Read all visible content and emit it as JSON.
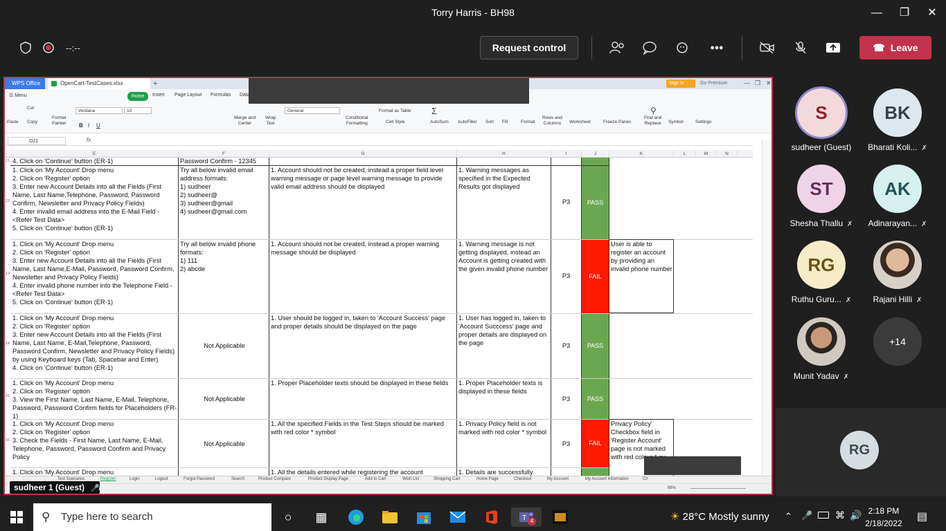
{
  "window": {
    "title": "Torry Harris - BH98"
  },
  "toolbar": {
    "timer": "--:--",
    "request_control": "Request control",
    "leave": "Leave"
  },
  "wps": {
    "app_tab": "WPS Office",
    "file_tab": "OpenCart-TestCases.xlsx",
    "sign_in": "Sign in",
    "go_premium": "Go Premium",
    "menu": [
      "Menu",
      "Home",
      "Insert",
      "Page Layout",
      "Formulas",
      "Data"
    ],
    "ribbon": {
      "paste": "Paste",
      "cut": "Cut",
      "copy": "Copy",
      "format_painter": "Format\nPainter",
      "font_name": "Verdana",
      "font_size": "10",
      "number_format": "General",
      "merge_center": "Merge and\nCenter",
      "wrap_text": "Wrap\nText",
      "conditional_formatting": "Conditional\nFormatting",
      "format_as_table": "Format as Table",
      "cell_style": "Cell Style",
      "autosum": "AutoSum",
      "autofilter": "AutoFilter",
      "sort": "Sort",
      "fill": "Fill",
      "format": "Format",
      "rows_columns": "Rows and\nColumns",
      "worksheet": "Worksheet",
      "freeze_panes": "Freeze Panes",
      "find_replace": "Find and\nReplace",
      "symbol": "Symbol",
      "settings": "Settings"
    },
    "cell_ref": "O21",
    "fx": "fx",
    "columns": [
      "E",
      "F",
      "G",
      "H",
      "I",
      "J",
      "K",
      "L",
      "M",
      "N"
    ],
    "top_row": {
      "num": "11",
      "e": "4. Click on 'Continue' button (ER-1)",
      "f": "Password Confirm - 12345"
    },
    "rows": [
      {
        "num": "12",
        "e": "1. Click on 'My Account' Drop menu\n2. Click on 'Register' option\n3. Enter new Account Details into all the Fields (First Name, Last Name,Telephone, Password, Password Confirm, Newsletter and  Privacy Policy Fields)\n4. Enter invalid email address into the E-Mail Field - <Refer Test Data>\n5. Click on 'Continue' button (ER-1)",
        "f": "Try all below invalid email address formats:\n1) sudheer\n2) sudheer@\n3) sudheer@gmail\n4) sudheer@gmail.com",
        "g": "1. Account should not be created, instead a proper field level warning message or page level warning message to provide valid email address should be displayed",
        "h": "1. Warning messages as specified in the Expected Results got displayed",
        "i": "P3",
        "j": "PASS",
        "k": ""
      },
      {
        "num": "13",
        "e": "1. Click on 'My Account' Drop menu\n2. Click on 'Register' option\n3. Enter new  Account Details into all the Fields (First Name, Last Name,E-Mail, Password, Password Confirm, Newsletter and  Privacy Policy Fields)\n4. Enter invalid phone number into the Telephone Field - <Refer Test Data>\n5. Click on 'Continue' button (ER-1)",
        "f": "Try all below invalid phone formats:\n1) 111\n2) abcde",
        "g": "1. Account should not be created, instead a proper warning message should be displayed",
        "h": "1. Warning message is not getting displayed, instead an Account is getting created with the given invalid phone number",
        "i": "P3",
        "j": "FAIL",
        "k": "User is able to register an account by providing an invalid phone number"
      },
      {
        "num": "14",
        "e": "1. Click on 'My Account' Drop menu\n2. Click on 'Register' option\n3. Enter new Account Details into all the Fields (First Name, Last Name, E-Mail,Telephone, Password, Password Confirm, Newsletter and Privacy Policy Fields) by using Keyboard keys (Tab, Spacebar and Enter)\n4. Click on 'Continue' button (ER-1)",
        "f": "Not Applicable",
        "g": "1. User should be logged in,  taken to 'Account Success' page and proper details should be displayed on the page",
        "h": "1. User has logged in, taken to 'Account Succcess' page and proper details are displayed on the page",
        "i": "P3",
        "j": "PASS",
        "k": ""
      },
      {
        "num": "15",
        "e": "1. Click on 'My Account' Drop menu\n2. Click on 'Register' option\n3. View the First Name, Last Name, E-Mail, Telephone, Password, Password Confirm fields for Placeholders (FR-1)",
        "f": "Not Applicable",
        "g": "1. Proper Placeholder texts should be displayed in these fields",
        "h": "1. Proper Placeholder texts is displayed in these fields",
        "i": "P3",
        "j": "PASS",
        "k": ""
      },
      {
        "num": "16",
        "e": "1. Click on 'My Account' Drop menu\n2. Click on 'Register' option\n3. Check the Fields - First Name, Last Name, E-Mail, Telephone, Password, Password Confirm and Privacy Policy",
        "f": "Not Applicable",
        "g": "1. All the specified Fields in the Test Steps should be marked with red color * symbol",
        "h": "1. Privacy Policy field is not marked with red color * symbol",
        "i": "P3",
        "j": "FAIL",
        "k": "Privacy Policy' Checkbox field in 'Register Account' page is not marked with red colour * sy"
      }
    ],
    "partial_row": {
      "num": "",
      "e": "1. Click on 'My Account' Drop menu",
      "g": "1. All the details entered while registering the account",
      "h": "1. Details are successfully"
    },
    "sheet_tabs": [
      "Test Scenarios",
      "Register",
      "Login",
      "Logout",
      "Forgot Password",
      "Search",
      "Product Compare",
      "Product Display Page",
      "Add to Cart",
      "Wish List",
      "Shopping Cart",
      "Home Page",
      "Checkout",
      "My Account",
      "My Account Information",
      "Ch"
    ],
    "active_sheet": "Register",
    "zoom": "88%"
  },
  "share_label": "sudheer 1 (Guest)",
  "participants": [
    {
      "initials": "S",
      "name": "sudheer (Guest)",
      "color": "#f4d9dc",
      "text": "#8a2431",
      "muted": false,
      "ring": true
    },
    {
      "initials": "BK",
      "name": "Bharati Koli...",
      "color": "#dde8ee",
      "text": "#36414a",
      "muted": true
    },
    {
      "initials": "ST",
      "name": "Shesha Thallu",
      "color": "#efd4e8",
      "text": "#6a2d5c",
      "muted": true
    },
    {
      "initials": "AK",
      "name": "Adinarayan...",
      "color": "#d6f0ee",
      "text": "#1f5653",
      "muted": true
    },
    {
      "initials": "RG",
      "name": "Ruthu Guru...",
      "color": "#f7ecc8",
      "text": "#6b5214",
      "muted": true
    },
    {
      "initials": "",
      "name": "Rajani Hilli",
      "color": "#c9b39a",
      "text": "#333",
      "muted": true,
      "photo": true
    },
    {
      "initials": "",
      "name": "Munit Yadav",
      "color": "#8a7a6a",
      "text": "#333",
      "muted": true,
      "photo": true
    },
    {
      "initials": "+14",
      "name": "",
      "color": "#3b3b3b",
      "text": "#fff",
      "muted": false
    }
  ],
  "self_tile": {
    "initials": "RG"
  },
  "taskbar": {
    "search_placeholder": "Type here to search",
    "weather": "28°C  Mostly sunny",
    "time": "2:18 PM",
    "date": "2/18/2022",
    "teams_badge": "4"
  }
}
